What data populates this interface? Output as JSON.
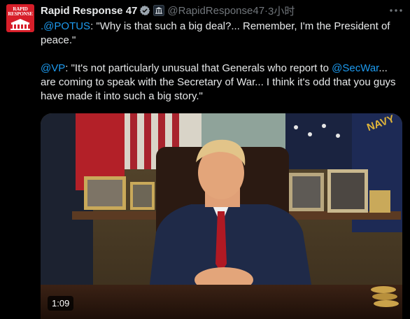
{
  "tweet": {
    "avatar": {
      "logo_line1": "RAPID",
      "logo_line2": "RESPONSE"
    },
    "display_name": "Rapid Response 47",
    "handle": "@RapidResponse47",
    "separator": "·",
    "time": "3小时",
    "text": {
      "p1_mention": ".@POTUS",
      "p1_body": ": \"Why is that such a big deal?... Remember, I'm the President of peace.\"",
      "p2_mention": "@VP",
      "p2_body_a": ": \"It's not particularly unusual that Generals who report to ",
      "p2_mention_b": "@SecWar",
      "p2_body_b": "... are coming to speak with the Secretary of War... I think it's odd that you guys have made it into such a big story.\""
    },
    "media": {
      "duration": "1:09",
      "flag_text": "NAVY"
    }
  },
  "icons": {
    "verified": "verified-badge-icon",
    "affiliation": "white-house-affiliation-icon",
    "more": "more-options-icon"
  },
  "colors": {
    "background": "#000000",
    "text": "#e7e9ea",
    "secondary_text": "#71767b",
    "link": "#1d9bf0",
    "avatar_red": "#d71e29"
  }
}
